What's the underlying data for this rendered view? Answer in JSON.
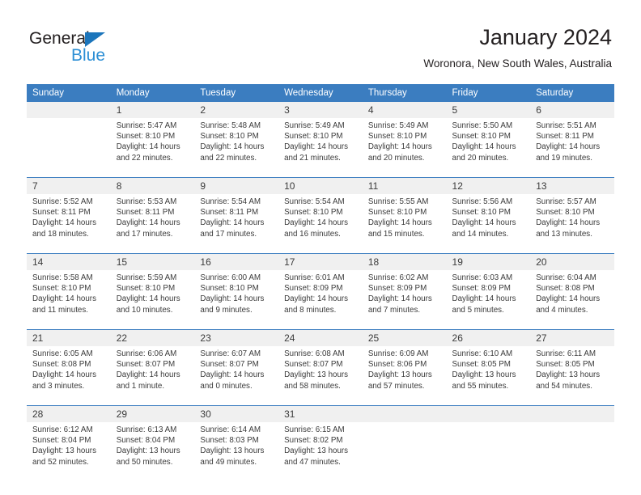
{
  "brand": {
    "name_top": "General",
    "name_bottom": "Blue",
    "triangle_color": "#1b75bb",
    "blue_text_color": "#2d8fd5"
  },
  "header": {
    "title": "January 2024",
    "location": "Woronora, New South Wales, Australia"
  },
  "theme": {
    "header_blue": "#3b7dc0",
    "daynum_band": "#f0f0f0",
    "text": "#3b3b3b"
  },
  "weekday_headers": [
    "Sunday",
    "Monday",
    "Tuesday",
    "Wednesday",
    "Thursday",
    "Friday",
    "Saturday"
  ],
  "weeks": [
    {
      "days": [
        {
          "date": "",
          "sunrise": "",
          "sunset": "",
          "daylight_1": "",
          "daylight_2": ""
        },
        {
          "date": "1",
          "sunrise": "Sunrise: 5:47 AM",
          "sunset": "Sunset: 8:10 PM",
          "daylight_1": "Daylight: 14 hours",
          "daylight_2": "and 22 minutes."
        },
        {
          "date": "2",
          "sunrise": "Sunrise: 5:48 AM",
          "sunset": "Sunset: 8:10 PM",
          "daylight_1": "Daylight: 14 hours",
          "daylight_2": "and 22 minutes."
        },
        {
          "date": "3",
          "sunrise": "Sunrise: 5:49 AM",
          "sunset": "Sunset: 8:10 PM",
          "daylight_1": "Daylight: 14 hours",
          "daylight_2": "and 21 minutes."
        },
        {
          "date": "4",
          "sunrise": "Sunrise: 5:49 AM",
          "sunset": "Sunset: 8:10 PM",
          "daylight_1": "Daylight: 14 hours",
          "daylight_2": "and 20 minutes."
        },
        {
          "date": "5",
          "sunrise": "Sunrise: 5:50 AM",
          "sunset": "Sunset: 8:10 PM",
          "daylight_1": "Daylight: 14 hours",
          "daylight_2": "and 20 minutes."
        },
        {
          "date": "6",
          "sunrise": "Sunrise: 5:51 AM",
          "sunset": "Sunset: 8:11 PM",
          "daylight_1": "Daylight: 14 hours",
          "daylight_2": "and 19 minutes."
        }
      ]
    },
    {
      "days": [
        {
          "date": "7",
          "sunrise": "Sunrise: 5:52 AM",
          "sunset": "Sunset: 8:11 PM",
          "daylight_1": "Daylight: 14 hours",
          "daylight_2": "and 18 minutes."
        },
        {
          "date": "8",
          "sunrise": "Sunrise: 5:53 AM",
          "sunset": "Sunset: 8:11 PM",
          "daylight_1": "Daylight: 14 hours",
          "daylight_2": "and 17 minutes."
        },
        {
          "date": "9",
          "sunrise": "Sunrise: 5:54 AM",
          "sunset": "Sunset: 8:11 PM",
          "daylight_1": "Daylight: 14 hours",
          "daylight_2": "and 17 minutes."
        },
        {
          "date": "10",
          "sunrise": "Sunrise: 5:54 AM",
          "sunset": "Sunset: 8:10 PM",
          "daylight_1": "Daylight: 14 hours",
          "daylight_2": "and 16 minutes."
        },
        {
          "date": "11",
          "sunrise": "Sunrise: 5:55 AM",
          "sunset": "Sunset: 8:10 PM",
          "daylight_1": "Daylight: 14 hours",
          "daylight_2": "and 15 minutes."
        },
        {
          "date": "12",
          "sunrise": "Sunrise: 5:56 AM",
          "sunset": "Sunset: 8:10 PM",
          "daylight_1": "Daylight: 14 hours",
          "daylight_2": "and 14 minutes."
        },
        {
          "date": "13",
          "sunrise": "Sunrise: 5:57 AM",
          "sunset": "Sunset: 8:10 PM",
          "daylight_1": "Daylight: 14 hours",
          "daylight_2": "and 13 minutes."
        }
      ]
    },
    {
      "days": [
        {
          "date": "14",
          "sunrise": "Sunrise: 5:58 AM",
          "sunset": "Sunset: 8:10 PM",
          "daylight_1": "Daylight: 14 hours",
          "daylight_2": "and 11 minutes."
        },
        {
          "date": "15",
          "sunrise": "Sunrise: 5:59 AM",
          "sunset": "Sunset: 8:10 PM",
          "daylight_1": "Daylight: 14 hours",
          "daylight_2": "and 10 minutes."
        },
        {
          "date": "16",
          "sunrise": "Sunrise: 6:00 AM",
          "sunset": "Sunset: 8:10 PM",
          "daylight_1": "Daylight: 14 hours",
          "daylight_2": "and 9 minutes."
        },
        {
          "date": "17",
          "sunrise": "Sunrise: 6:01 AM",
          "sunset": "Sunset: 8:09 PM",
          "daylight_1": "Daylight: 14 hours",
          "daylight_2": "and 8 minutes."
        },
        {
          "date": "18",
          "sunrise": "Sunrise: 6:02 AM",
          "sunset": "Sunset: 8:09 PM",
          "daylight_1": "Daylight: 14 hours",
          "daylight_2": "and 7 minutes."
        },
        {
          "date": "19",
          "sunrise": "Sunrise: 6:03 AM",
          "sunset": "Sunset: 8:09 PM",
          "daylight_1": "Daylight: 14 hours",
          "daylight_2": "and 5 minutes."
        },
        {
          "date": "20",
          "sunrise": "Sunrise: 6:04 AM",
          "sunset": "Sunset: 8:08 PM",
          "daylight_1": "Daylight: 14 hours",
          "daylight_2": "and 4 minutes."
        }
      ]
    },
    {
      "days": [
        {
          "date": "21",
          "sunrise": "Sunrise: 6:05 AM",
          "sunset": "Sunset: 8:08 PM",
          "daylight_1": "Daylight: 14 hours",
          "daylight_2": "and 3 minutes."
        },
        {
          "date": "22",
          "sunrise": "Sunrise: 6:06 AM",
          "sunset": "Sunset: 8:07 PM",
          "daylight_1": "Daylight: 14 hours",
          "daylight_2": "and 1 minute."
        },
        {
          "date": "23",
          "sunrise": "Sunrise: 6:07 AM",
          "sunset": "Sunset: 8:07 PM",
          "daylight_1": "Daylight: 14 hours",
          "daylight_2": "and 0 minutes."
        },
        {
          "date": "24",
          "sunrise": "Sunrise: 6:08 AM",
          "sunset": "Sunset: 8:07 PM",
          "daylight_1": "Daylight: 13 hours",
          "daylight_2": "and 58 minutes."
        },
        {
          "date": "25",
          "sunrise": "Sunrise: 6:09 AM",
          "sunset": "Sunset: 8:06 PM",
          "daylight_1": "Daylight: 13 hours",
          "daylight_2": "and 57 minutes."
        },
        {
          "date": "26",
          "sunrise": "Sunrise: 6:10 AM",
          "sunset": "Sunset: 8:05 PM",
          "daylight_1": "Daylight: 13 hours",
          "daylight_2": "and 55 minutes."
        },
        {
          "date": "27",
          "sunrise": "Sunrise: 6:11 AM",
          "sunset": "Sunset: 8:05 PM",
          "daylight_1": "Daylight: 13 hours",
          "daylight_2": "and 54 minutes."
        }
      ]
    },
    {
      "days": [
        {
          "date": "28",
          "sunrise": "Sunrise: 6:12 AM",
          "sunset": "Sunset: 8:04 PM",
          "daylight_1": "Daylight: 13 hours",
          "daylight_2": "and 52 minutes."
        },
        {
          "date": "29",
          "sunrise": "Sunrise: 6:13 AM",
          "sunset": "Sunset: 8:04 PM",
          "daylight_1": "Daylight: 13 hours",
          "daylight_2": "and 50 minutes."
        },
        {
          "date": "30",
          "sunrise": "Sunrise: 6:14 AM",
          "sunset": "Sunset: 8:03 PM",
          "daylight_1": "Daylight: 13 hours",
          "daylight_2": "and 49 minutes."
        },
        {
          "date": "31",
          "sunrise": "Sunrise: 6:15 AM",
          "sunset": "Sunset: 8:02 PM",
          "daylight_1": "Daylight: 13 hours",
          "daylight_2": "and 47 minutes."
        },
        {
          "date": "",
          "sunrise": "",
          "sunset": "",
          "daylight_1": "",
          "daylight_2": ""
        },
        {
          "date": "",
          "sunrise": "",
          "sunset": "",
          "daylight_1": "",
          "daylight_2": ""
        },
        {
          "date": "",
          "sunrise": "",
          "sunset": "",
          "daylight_1": "",
          "daylight_2": ""
        }
      ]
    }
  ]
}
